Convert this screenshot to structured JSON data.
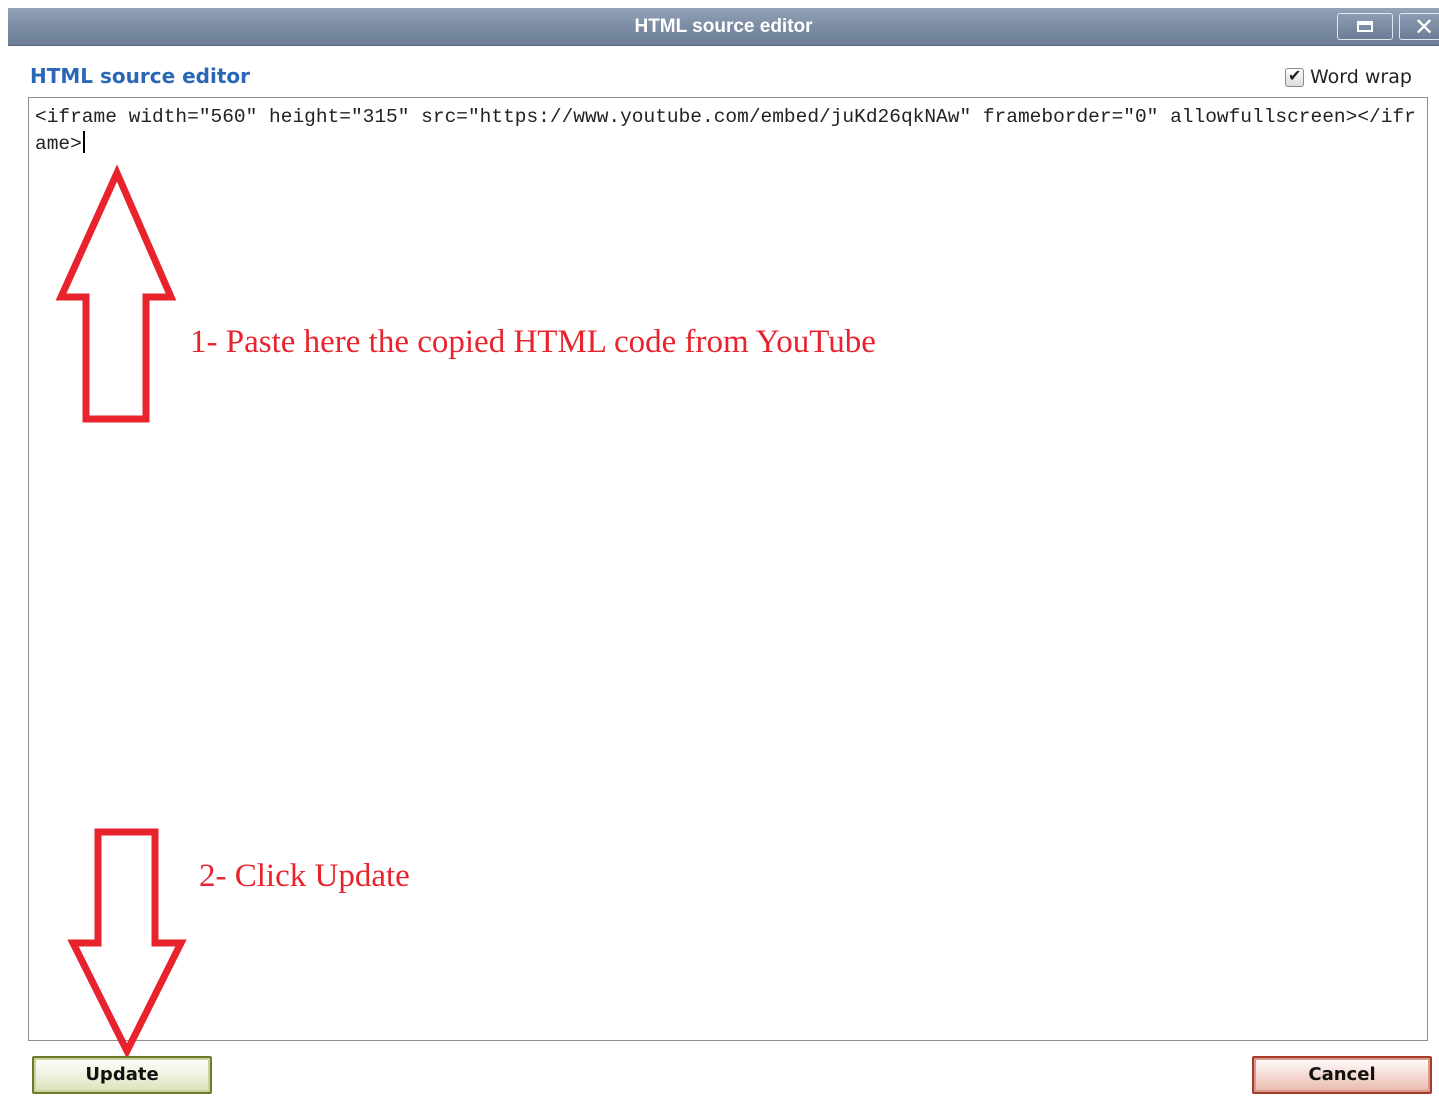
{
  "window": {
    "title": "HTML source editor",
    "maximize_icon": "maximize-icon",
    "close_icon": "close-icon",
    "close_glyph": "✕"
  },
  "dialog": {
    "heading": "HTML source editor",
    "heading_color": "#2b67b7",
    "word_wrap": {
      "label": "Word wrap",
      "checked": true,
      "check_glyph": "✔"
    }
  },
  "editor": {
    "content": "<iframe width=\"560\" height=\"315\" src=\"https://www.youtube.com/embed/juKd26qkNAw\" frameborder=\"0\" allowfullscreen></iframe>"
  },
  "annotations": {
    "step1": "1- Paste here the copied HTML code from YouTube",
    "step2": "2- Click Update",
    "color": "#e8232d",
    "step1_arrow": "up-arrow",
    "step2_arrow": "down-arrow"
  },
  "buttons": {
    "update_label": "Update",
    "cancel_label": "Cancel"
  }
}
